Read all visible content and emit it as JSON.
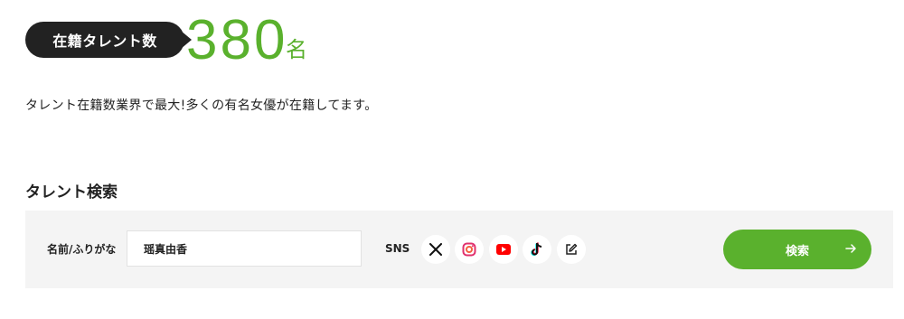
{
  "talent_count": {
    "badge_label": "在籍タレント数",
    "number": "380",
    "unit": "名",
    "accent_color": "#5ab12d"
  },
  "lead_text": "タレント在籍数業界で最大!多くの有名女優が在籍してます。",
  "search": {
    "section_title": "タレント検索",
    "name_label": "名前/ふりがな",
    "name_value": "瑶真由香",
    "sns_label": "SNS",
    "sns_icons": [
      "x-icon",
      "instagram-icon",
      "youtube-icon",
      "tiktok-icon",
      "blog-edit-icon"
    ],
    "submit_label": "検索"
  }
}
